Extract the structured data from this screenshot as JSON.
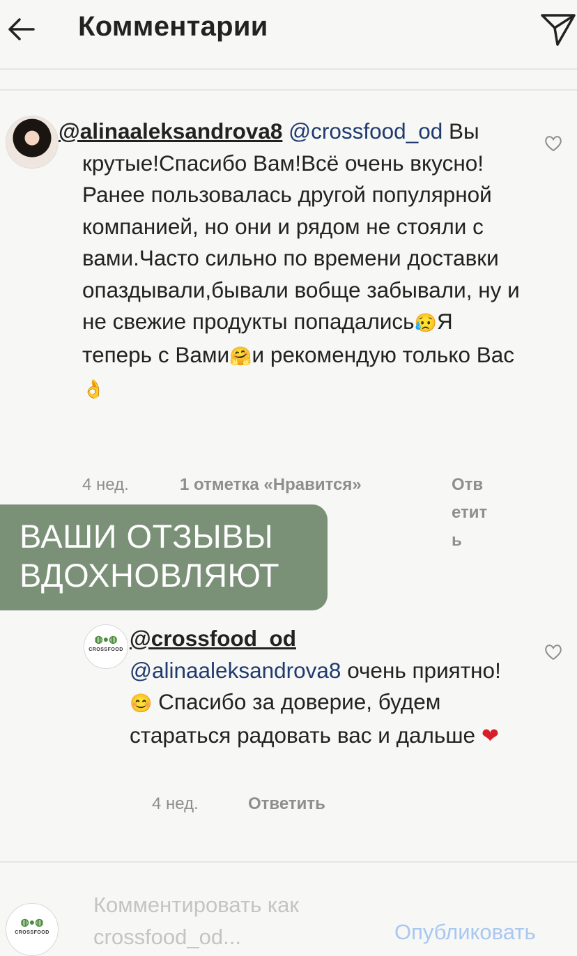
{
  "header": {
    "title": "Комментарии",
    "back_icon": "arrow-left-icon",
    "send_icon": "paper-plane-icon"
  },
  "comment": {
    "username": "@alinaaleksandrova8",
    "mention": "@crossfood_od",
    "text_1": "Вы крутые!Спасибо Вам!Всё очень вкусно!Ранее пользовалась другой популярной компанией, но они и рядом не стояли с вами.Часто сильно по времени доставки опаздывали,бывали вобще забывали, ну и не свежие продукты попадались",
    "emoji_1": "😥",
    "text_2": "Я теперь с Вами",
    "emoji_2": "🤗",
    "text_3": "и рекомендую только Вас",
    "emoji_3": "👌",
    "time": "4 нед.",
    "likes": "1 отметка «Нравится»",
    "reply_label": "Ответить",
    "like_icon": "heart-outline-icon"
  },
  "banner": {
    "text": "ВАШИ ОТЗЫВЫ\nВДОХНОВЛЯЮТ",
    "color": "#7a9077"
  },
  "reply": {
    "username": "@crossfood_od",
    "mention": "@alinaaleksandrova8",
    "text_1": "очень приятно!",
    "emoji_1": "😊",
    "text_2": "Спасибо за доверие, будем стараться радовать вас и дальше",
    "emoji_2": "❤",
    "time": "4 нед.",
    "reply_label": "Ответить",
    "avatar_logo": "CROSSFOOD",
    "like_icon": "heart-outline-icon"
  },
  "input": {
    "placeholder": "Комментировать как\ncrossfood_od...",
    "publish_label": "Опубликовать",
    "avatar_logo": "CROSSFOOD"
  }
}
